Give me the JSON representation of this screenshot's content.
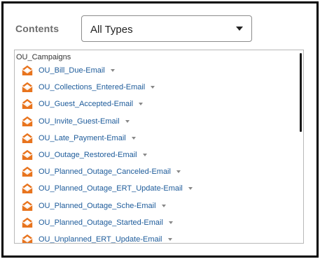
{
  "contents_label": "Contents",
  "type_select": {
    "value": "All Types"
  },
  "tree": {
    "folder": "OU_Campaigns",
    "items": [
      {
        "label": "OU_Bill_Due-Email"
      },
      {
        "label": "OU_Collections_Entered-Email"
      },
      {
        "label": "OU_Guest_Accepted-Email"
      },
      {
        "label": "OU_Invite_Guest-Email"
      },
      {
        "label": "OU_Late_Payment-Email"
      },
      {
        "label": "OU_Outage_Restored-Email"
      },
      {
        "label": "OU_Planned_Outage_Canceled-Email"
      },
      {
        "label": "OU_Planned_Outage_ERT_Update-Email"
      },
      {
        "label": "OU_Planned_Outage_Sche-Email"
      },
      {
        "label": "OU_Planned_Outage_Started-Email"
      },
      {
        "label": "OU_Unplanned_ERT_Update-Email"
      }
    ]
  },
  "colors": {
    "icon_orange": "#e8741e",
    "link_blue": "#1d5b9a"
  }
}
